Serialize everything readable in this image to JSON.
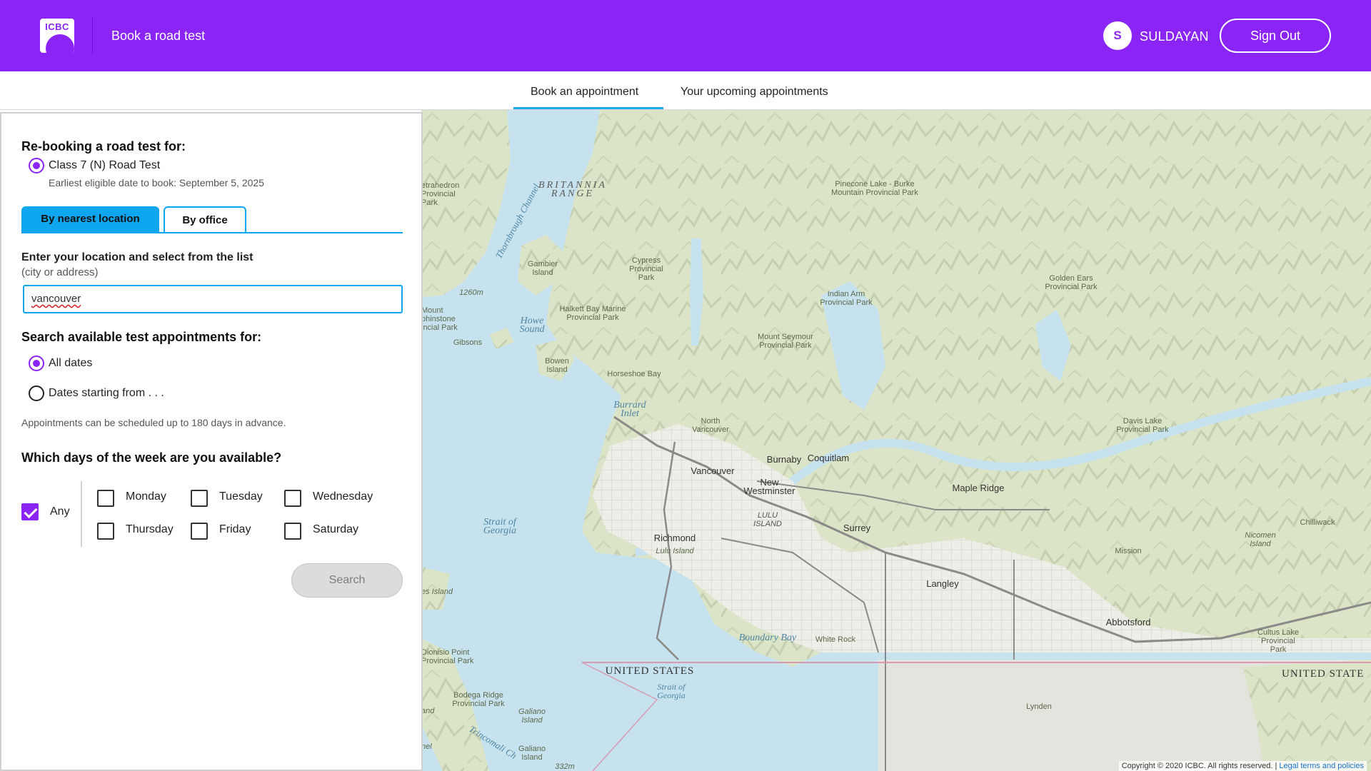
{
  "header": {
    "logo_text": "ICBC",
    "title": "Book a road test",
    "avatar_initial": "S",
    "username": "SULDAYAN",
    "sign_out_label": "Sign Out"
  },
  "tabs": {
    "book": "Book an appointment",
    "upcoming": "Your upcoming appointments",
    "active": "book"
  },
  "panel": {
    "rebooking_heading": "Re-booking a road test for:",
    "test_type": "Class 7 (N) Road Test",
    "earliest_date": "Earliest eligible date to book: September 5, 2025",
    "search_tabs": {
      "nearest": "By nearest location",
      "office": "By office",
      "active": "nearest"
    },
    "location_label": "Enter your location and select from the list",
    "location_hint": "(city or address)",
    "location_value": "vancouver",
    "search_heading": "Search available test appointments for:",
    "date_options": {
      "all": "All dates",
      "starting": "Dates starting from . . .",
      "selected": "all"
    },
    "advance_note": "Appointments can be scheduled up to 180 days in advance.",
    "days_heading": "Which days of the week are you available?",
    "days": {
      "any": "Any",
      "monday": "Monday",
      "tuesday": "Tuesday",
      "wednesday": "Wednesday",
      "thursday": "Thursday",
      "friday": "Friday",
      "saturday": "Saturday",
      "any_checked": true
    },
    "search_button": "Search"
  },
  "map": {
    "labels": {
      "britannia": "BRITANNIA RANGE",
      "pinecone": "Pinecone Lake - Burke Mountain Provincial Park",
      "golden_ears": "Golden Ears Provincial Park",
      "indian_arm": "Indian Arm Provincial Park",
      "mount_seymour": "Mount Seymour Provincial Park",
      "cypress": "Cypress Provincial Park",
      "halkett": "Halkett Bay Marine Provincial Park",
      "gambier": "Gambier Island",
      "bowen": "Bowen Island",
      "howe_sound": "Howe Sound",
      "thornbrough": "Thornbrough Channel",
      "gibsons": "Gibsons",
      "horseshoe": "Horseshoe Bay",
      "burrard": "Burrard Inlet",
      "north_van": "North Vancouver",
      "vancouver": "Vancouver",
      "burnaby": "Burnaby",
      "coquitlam": "Coquitlam",
      "new_west": "New Westminster",
      "lulu": "LULU ISLAND",
      "richmond": "Richmond",
      "lulu_island": "Lulu Island",
      "surrey": "Surrey",
      "maple_ridge": "Maple Ridge",
      "langley": "Langley",
      "abbotsford": "Abbotsford",
      "mission": "Mission",
      "chilliwack": "Chilliwack",
      "davis_lake": "Davis Lake Provincial Park",
      "cultus": "Cultus Lake Provincial Park",
      "nicomen": "Nicomen Island",
      "strait_georgia": "Strait of Georgia",
      "boundary_bay": "Boundary Bay",
      "white_rock": "White Rock",
      "us1": "UNITED STATES",
      "us2": "UNITED STATE",
      "strait_georgia_us": "Strait of Georgia",
      "lynden": "Lynden",
      "dionisio": "Dionisio Point Provincial Park",
      "bodega": "Bodega Ridge Provincial Park",
      "galiano": "Galiano Island",
      "galiano2": "Galiano Island",
      "trincomali": "Trincomali Ch",
      "tetrahedron": "etrahedron Provincial Park",
      "mount_elphinstone": "Mount phinstone incial Park",
      "es_island": "es Island",
      "and": "and",
      "nel": "nel",
      "elev_1260": "1260m",
      "elev_332": "332m"
    },
    "copyright": "Copyright © 2020 ICBC. All rights reserved.",
    "legal_link": "Legal terms and policies"
  },
  "colors": {
    "brand_purple": "#8a24f7",
    "accent_blue": "#0ea6ef",
    "water": "#c7e2ef",
    "land": "#dfe6cf"
  }
}
